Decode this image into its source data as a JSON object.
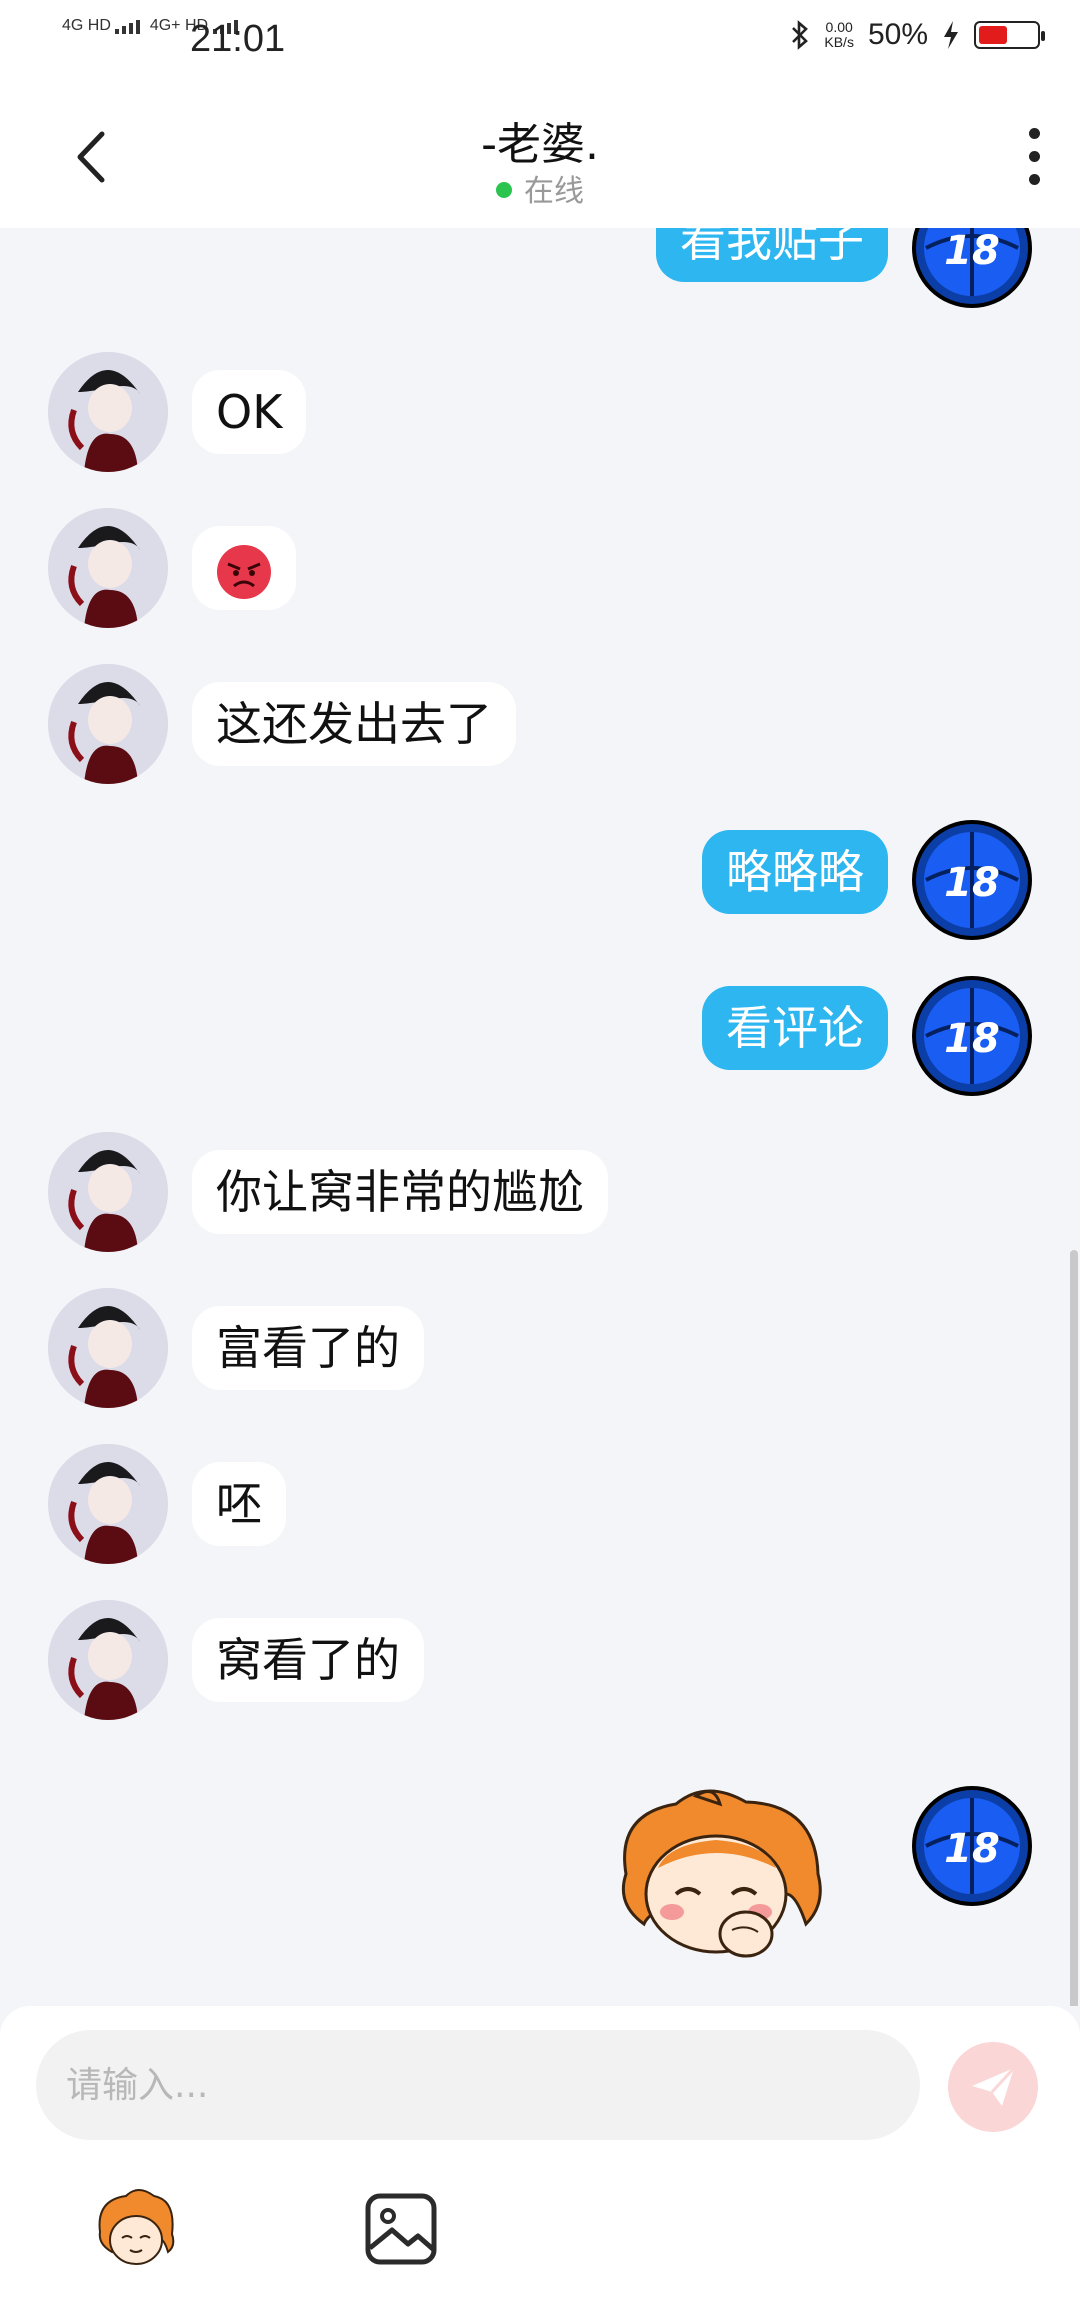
{
  "status_bar": {
    "network_1": "4G HD",
    "network_2": "4G+ HD",
    "time": "21:01",
    "speed_value": "0.00",
    "speed_unit": "KB/s",
    "battery": "50%",
    "battery_level": 0.5
  },
  "header": {
    "title": "-老婆.",
    "status": "在线"
  },
  "messages": [
    {
      "side": "out",
      "text": "看我贴子"
    },
    {
      "side": "in",
      "text": "OK"
    },
    {
      "side": "in",
      "emoji": "angry-face"
    },
    {
      "side": "in",
      "text": "这还发出去了"
    },
    {
      "side": "out",
      "text": "略略略"
    },
    {
      "side": "out",
      "text": "看评论"
    },
    {
      "side": "in",
      "text": "你让窝非常的尴尬"
    },
    {
      "side": "in",
      "text": "富看了的"
    },
    {
      "side": "in",
      "text": "呸"
    },
    {
      "side": "in",
      "text": "窝看了的"
    },
    {
      "side": "out",
      "sticker": "laughing-girl-sticker"
    }
  ],
  "input": {
    "placeholder": "请输入..."
  },
  "colors": {
    "outgoing_bubble": "#2db6ef",
    "incoming_bubble": "#ffffff",
    "online": "#2bc44f",
    "send_button": "#fbd6d6"
  }
}
